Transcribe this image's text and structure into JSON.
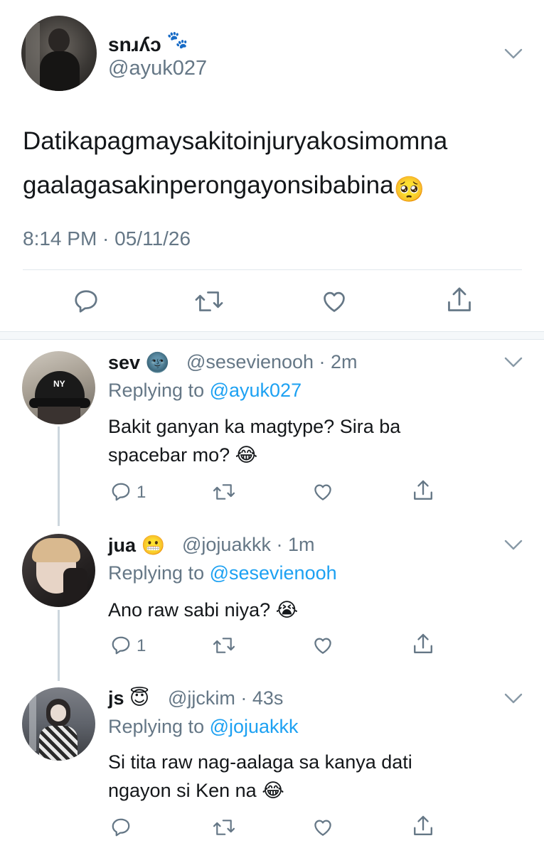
{
  "main_tweet": {
    "display_name": "snɹʎɔ",
    "name_emoji": "🐾",
    "handle": "@ayuk027",
    "text": "Datikapagmaysakitoinjuryakosimomna gaalagasakinperongayonsibabina",
    "text_emoji": "🥺",
    "timestamp": "8:14 PM · 05/11/26"
  },
  "replies": [
    {
      "name": "sev",
      "name_emoji": "🌚",
      "handle_time": "@sesevienooh · 2m",
      "replying_prefix": "Replying to ",
      "replying_to": "@ayuk027",
      "text_line1": "Bakit ganyan ka magtype? Sira ba",
      "text_line2": "spacebar mo?",
      "text_emoji": "😂",
      "reply_count": "1"
    },
    {
      "name": "jua",
      "name_emoji": "😬",
      "handle_time": "@jojuakkk · 1m",
      "replying_prefix": "Replying to ",
      "replying_to": "@sesevienooh",
      "text_line1": "Ano raw sabi niya?",
      "text_emoji": "😭",
      "reply_count": "1"
    },
    {
      "name": "js",
      "name_emoji": "😇",
      "handle_time": "@jjckim · 43s",
      "replying_prefix": "Replying to ",
      "replying_to": "@jojuakkk",
      "text_line1": "Si tita raw nag-aalaga sa kanya dati",
      "text_line2": "ngayon si Ken na",
      "text_emoji": "😂",
      "reply_count": ""
    }
  ],
  "colors": {
    "text_primary": "#14171a",
    "text_secondary": "#657786",
    "link": "#1da1f2",
    "divider": "#e1e8ed"
  },
  "icons": [
    "reply-icon",
    "retweet-icon",
    "like-icon",
    "share-icon",
    "chevron-down-icon"
  ]
}
